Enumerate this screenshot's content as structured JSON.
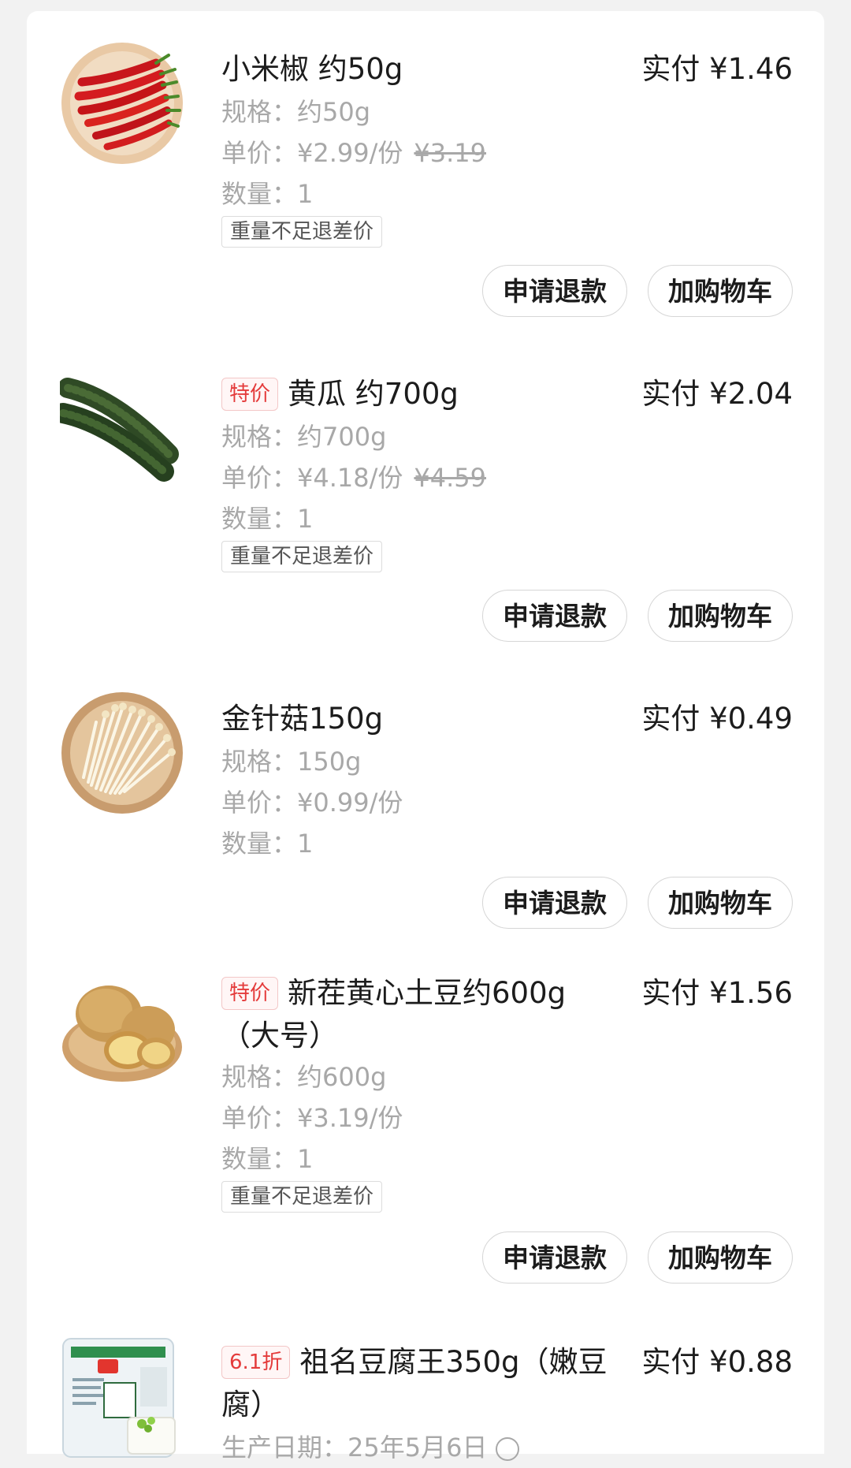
{
  "labels": {
    "refund": "申请退款",
    "cart": "加购物车",
    "weight_note": "重量不足退差价"
  },
  "items": [
    {
      "image": "red-chili-pepper",
      "title": "小米椒 约50g",
      "tag": "",
      "paid": "实付 ¥1.46",
      "spec": "规格：约50g",
      "unit_price": "单价：¥2.99/份",
      "original_price": "¥3.19",
      "quantity": "数量：1"
    },
    {
      "image": "cucumber",
      "title": "黄瓜 约700g",
      "tag": "特价",
      "paid": "实付 ¥2.04",
      "spec": "规格：约700g",
      "unit_price": "单价：¥4.18/份",
      "original_price": "¥4.59",
      "quantity": "数量：1"
    },
    {
      "image": "enoki-mushroom",
      "title": "金针菇150g",
      "tag": "",
      "paid": "实付 ¥0.49",
      "spec": "规格：150g",
      "unit_price": "单价：¥0.99/份",
      "original_price": "",
      "quantity": "数量：1"
    },
    {
      "image": "potato",
      "title": "新茬黄心土豆约600g（大号）",
      "tag": "特价",
      "paid": "实付 ¥1.56",
      "spec": "规格：约600g",
      "unit_price": "单价：¥3.19/份",
      "original_price": "",
      "quantity": "数量：1"
    },
    {
      "image": "tofu-package",
      "title": "祖名豆腐王350g（嫩豆腐）",
      "tag": "6.1折",
      "paid": "实付 ¥0.88",
      "production_date": "生产日期：25年5月6日"
    }
  ]
}
